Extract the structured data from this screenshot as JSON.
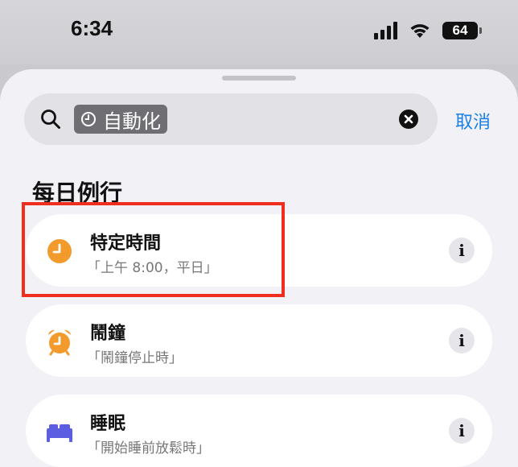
{
  "status_bar": {
    "time": "6:34",
    "battery": "64",
    "icons": [
      "cellular-signal-icon",
      "wifi-icon",
      "battery-icon"
    ]
  },
  "search": {
    "token_label": "自動化",
    "token_icon": "clock-icon",
    "cancel_label": "取消"
  },
  "section": {
    "title": "每日例行"
  },
  "rows": [
    {
      "title": "特定時間",
      "subtitle": "「上午 8:00，平日」",
      "icon": "clock-icon",
      "info": "i"
    },
    {
      "title": "鬧鐘",
      "subtitle": "「鬧鐘停止時」",
      "icon": "alarm-clock-icon",
      "info": "i"
    },
    {
      "title": "睡眠",
      "subtitle": "「開始睡前放鬆時」",
      "icon": "bed-icon",
      "info": "i"
    }
  ],
  "colors": {
    "accent": "#1a80e6",
    "clock_orange": "#f39a2c",
    "bed_purple": "#5b5ee0",
    "highlight": "#ef2e1d"
  }
}
